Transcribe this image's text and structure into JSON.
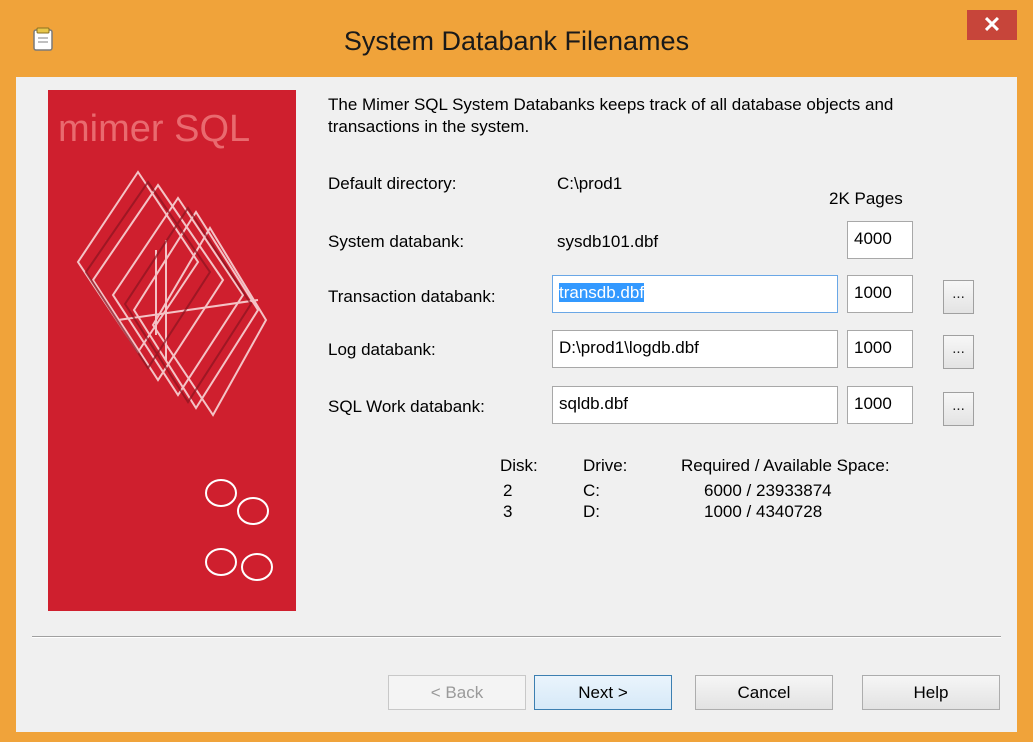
{
  "window": {
    "title": "System Databank Filenames",
    "close_label": "✕",
    "titlebar_color": "#f0a33a",
    "close_color": "#c7453a"
  },
  "banner": {
    "logo_text": "mimer SQL",
    "background_color": "#cf1f2e"
  },
  "description": "The Mimer SQL System Databanks keeps track of all database objects and transactions in the system.",
  "fields": {
    "default_directory_label": "Default directory:",
    "default_directory_value": "C:\\prod1",
    "pages_header": "2K Pages",
    "system_label": "System databank:",
    "system_value": "sysdb101.dbf",
    "system_pages": "4000",
    "transaction_label": "Transaction databank:",
    "transaction_value": "transdb.dbf",
    "transaction_pages": "1000",
    "log_label": "Log databank:",
    "log_value": "D:\\prod1\\logdb.dbf",
    "log_pages": "1000",
    "sqlwork_label": "SQL Work databank:",
    "sqlwork_value": "sqldb.dbf",
    "sqlwork_pages": "1000",
    "browse_label": "..."
  },
  "disk_table": {
    "headers": [
      "Disk:",
      "Drive:",
      "Required / Available Space:"
    ],
    "rows": [
      {
        "disk": "2",
        "drive": "C:",
        "space": "6000 / 23933874"
      },
      {
        "disk": "3",
        "drive": "D:",
        "space": "1000 / 4340728"
      }
    ]
  },
  "buttons": {
    "back": "< Back",
    "next": "Next >",
    "cancel": "Cancel",
    "help": "Help"
  }
}
